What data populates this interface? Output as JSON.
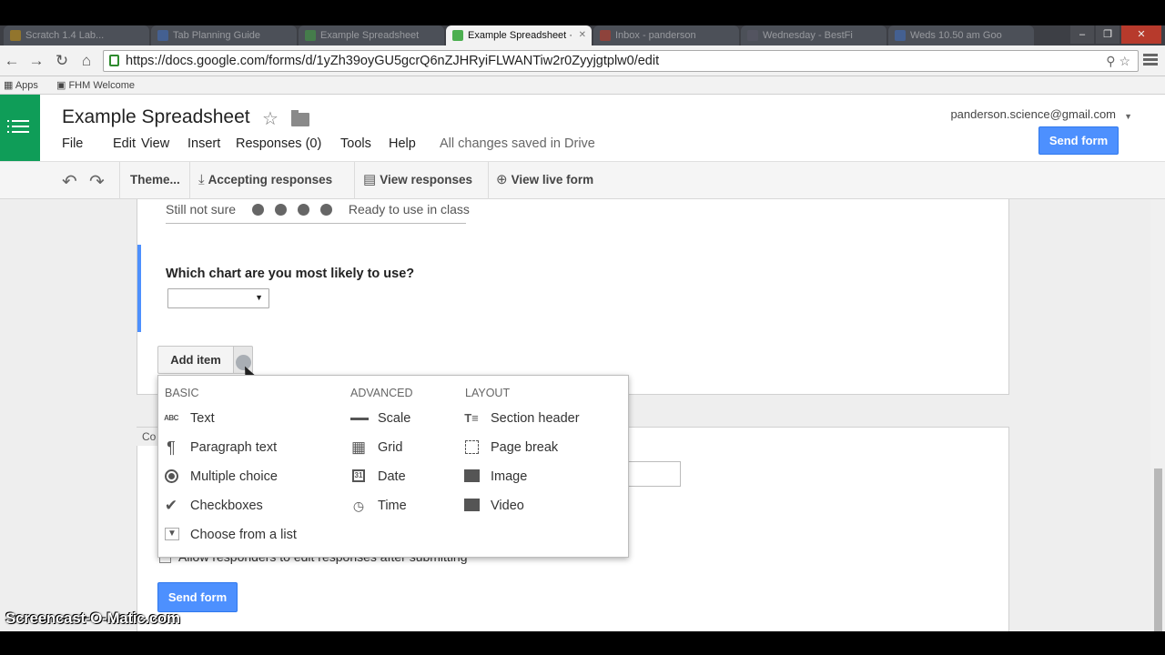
{
  "browser": {
    "tabs": [
      {
        "label": "Scratch 1.4 Lab..."
      },
      {
        "label": "Tab Planning Guide"
      },
      {
        "label": "Example Spreadsheet"
      },
      {
        "label": "Example Spreadsheet ·"
      },
      {
        "label": "Inbox - panderson"
      },
      {
        "label": "Wednesday - BestFi"
      },
      {
        "label": "Weds 10.50 am Goo"
      }
    ],
    "active_tab": 3,
    "url": "https://docs.google.com/forms/d/1yZh39oyGU5gcrQ6nZJHRyiFLWANTiw2r0Zyyjgtplw0/edit",
    "bookmarks": [
      "Apps",
      "FHM Welcome"
    ]
  },
  "doc": {
    "title": "Example Spreadsheet",
    "menu": [
      "File",
      "Edit",
      "View",
      "Insert",
      "Responses (0)",
      "Tools",
      "Help"
    ],
    "saved_status": "All changes saved in Drive",
    "account": "panderson.science@gmail.com",
    "send_form_label": "Send form"
  },
  "toolbar": {
    "theme_label": "Theme...",
    "accepting_label": "Accepting responses",
    "view_responses_label": "View responses",
    "view_live_label": "View live form"
  },
  "form": {
    "scale_low": "Still not sure",
    "scale_high": "Ready to use in class",
    "question": "Which chart are you most likely to use?",
    "add_item_label": "Add item",
    "card2_tag": "Co",
    "allow_edit_label": "Allow responders to edit responses after submitting",
    "send_form_label": "Send form"
  },
  "add_menu": {
    "basic": {
      "heading": "BASIC",
      "items": [
        "Text",
        "Paragraph text",
        "Multiple choice",
        "Checkboxes",
        "Choose from a list"
      ]
    },
    "advanced": {
      "heading": "ADVANCED",
      "items": [
        "Scale",
        "Grid",
        "Date",
        "Time"
      ]
    },
    "layout": {
      "heading": "LAYOUT",
      "items": [
        "Section header",
        "Page break",
        "Image",
        "Video"
      ]
    },
    "icons": {
      "text": "ABC",
      "scale": "scale-icon",
      "grid": "grid-icon",
      "date": "calendar-icon",
      "time": "clock-icon"
    }
  },
  "watermark": "Screencast-O-Matic.com"
}
